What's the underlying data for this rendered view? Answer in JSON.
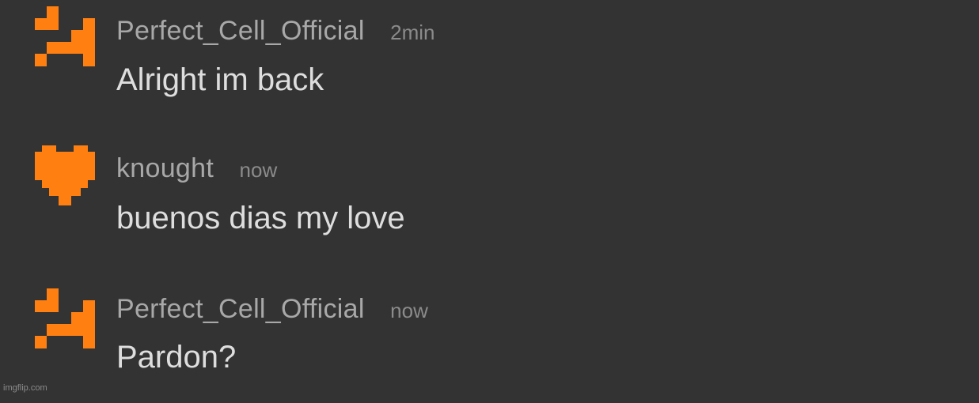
{
  "accent_color": "#ff7f11",
  "messages": [
    {
      "avatar_icon": "pixel-frown-face-icon",
      "username": "Perfect_Cell_Official",
      "timestamp": "2min",
      "text": "Alright im back"
    },
    {
      "avatar_icon": "pixel-heart-icon",
      "username": "knought",
      "timestamp": "now",
      "text": "buenos dias my love"
    },
    {
      "avatar_icon": "pixel-frown-face-icon",
      "username": "Perfect_Cell_Official",
      "timestamp": "now",
      "text": "Pardon?"
    }
  ],
  "watermark": "imgflip.com"
}
